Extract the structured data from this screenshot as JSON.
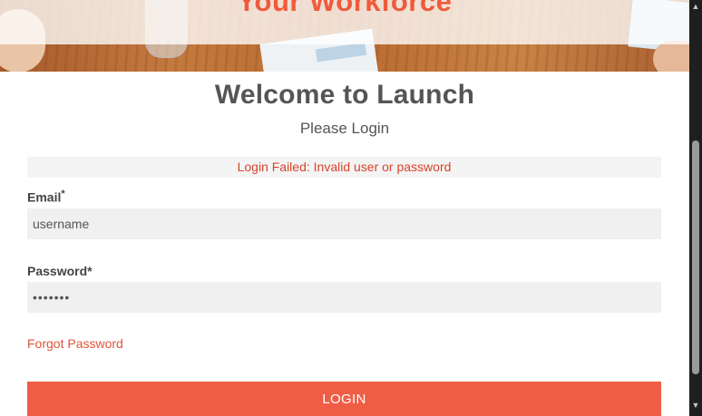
{
  "hero": {
    "title": "Your Workforce"
  },
  "login": {
    "heading": "Welcome to Launch",
    "subtitle": "Please Login",
    "error_message": "Login Failed: Invalid user or password",
    "email_label": "Email",
    "email_required_mark": "*",
    "email_value": "username",
    "password_label": "Password*",
    "password_value": "•••••••",
    "forgot_password_link": "Forgot Password",
    "login_button": "LOGIN"
  },
  "colors": {
    "accent": "#f05d45",
    "error": "#d9442b",
    "heading": "#555555",
    "field_background": "#f0f0f0"
  },
  "icons": {
    "scroll_up": "triangle-up-icon",
    "scroll_down": "triangle-down-icon"
  }
}
